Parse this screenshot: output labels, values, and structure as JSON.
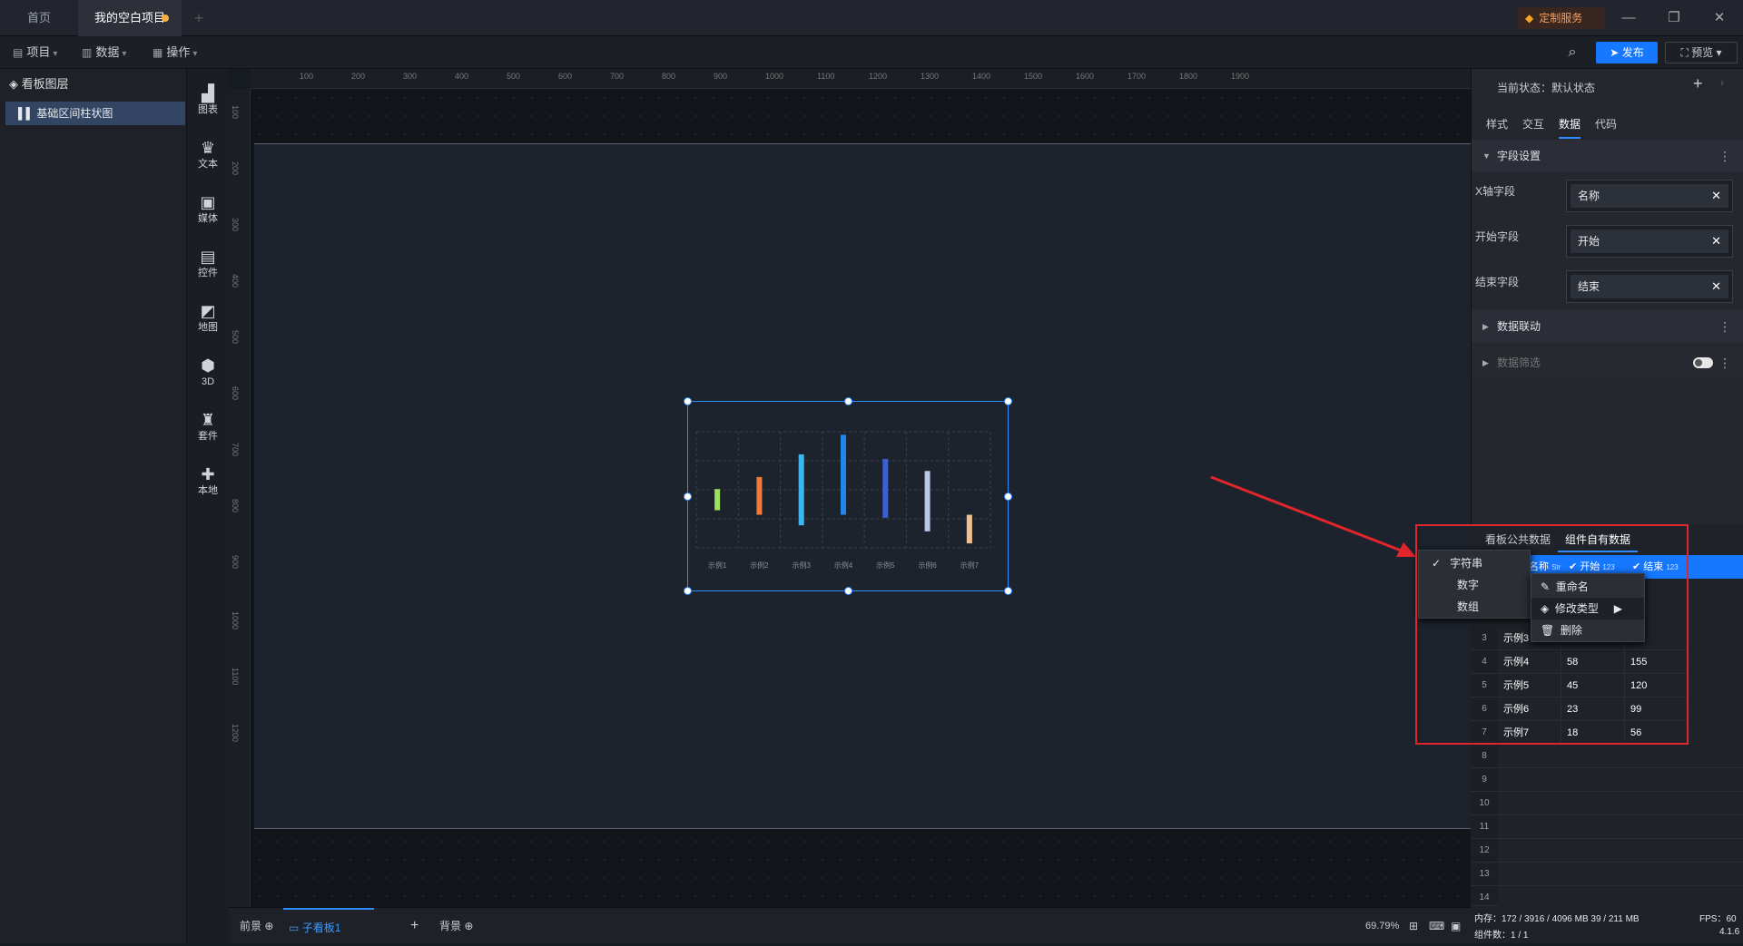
{
  "tabs": {
    "home": "首页",
    "project": "我的空白项目",
    "custom_service": "定制服务"
  },
  "menu": {
    "project": "项目",
    "data": "数据",
    "ops": "操作"
  },
  "toolbar": {
    "publish": "发布",
    "preview": "预览"
  },
  "layers": {
    "title": "看板图层",
    "item": "基础区间柱状图"
  },
  "tools": [
    "图表",
    "文本",
    "媒体",
    "控件",
    "地图",
    "3D",
    "套件",
    "本地"
  ],
  "ruler_top": [
    "100",
    "200",
    "300",
    "400",
    "500",
    "600",
    "700",
    "800",
    "900",
    "1000",
    "1100",
    "1200",
    "1300",
    "1400",
    "1500",
    "1600",
    "1700",
    "1800",
    "1900"
  ],
  "ruler_left": [
    "100",
    "200",
    "300",
    "400",
    "500",
    "600",
    "700",
    "800",
    "900",
    "1000",
    "1100",
    "1200"
  ],
  "chart_data": {
    "type": "bar",
    "categories": [
      "示例1",
      "示例2",
      "示例3",
      "示例4",
      "示例5",
      "示例6",
      "示例7"
    ],
    "ranges": [
      [
        null,
        null
      ],
      [
        null,
        null
      ],
      [
        null,
        null
      ],
      [
        null,
        null
      ],
      [
        58,
        155
      ],
      [
        45,
        120
      ],
      [
        23,
        99
      ]
    ],
    "colors": [
      "#a0e060",
      "#f07a3a",
      "#3cb6f0",
      "#2186e8",
      "#3b5fd8",
      "#b8c8e8",
      "#f0c090"
    ]
  },
  "bottom": {
    "front": "前景",
    "sub": "子看板1",
    "back": "背景",
    "zoom": "69.79%"
  },
  "panel": {
    "state_label": "当前状态：默认状态",
    "tabs": [
      "样式",
      "交互",
      "数据",
      "代码"
    ],
    "field_section": "字段设置",
    "x_label": "X轴字段",
    "x_value": "名称",
    "start_label": "开始字段",
    "start_value": "开始",
    "end_label": "结束字段",
    "end_value": "结束",
    "link_section": "数据联动",
    "filter_section": "数据筛选",
    "data_tabs": [
      "看板公共数据",
      "组件自有数据"
    ],
    "col_name": "名称",
    "col_name_type": "Str",
    "col_start": "开始",
    "col_start_type": "123",
    "col_end": "结束",
    "col_end_type": "123"
  },
  "rows": [
    {
      "n": "3",
      "name": "示例3",
      "start": "",
      "end": ""
    },
    {
      "n": "4",
      "name": "示例4",
      "start": "58",
      "end": "155"
    },
    {
      "n": "5",
      "name": "示例5",
      "start": "45",
      "end": "120"
    },
    {
      "n": "6",
      "name": "示例6",
      "start": "23",
      "end": "99"
    },
    {
      "n": "7",
      "name": "示例7",
      "start": "18",
      "end": "56"
    }
  ],
  "empty_rows": [
    "8",
    "9",
    "10",
    "11",
    "12",
    "13",
    "14"
  ],
  "type_menu": [
    "字符串",
    "数字",
    "数组"
  ],
  "action_menu": [
    "重命名",
    "修改类型",
    "删除"
  ],
  "status": {
    "memory": "内存：172 / 3916 / 4096 MB 39 / 211 MB",
    "fps": "FPS：60",
    "components": "组件数：1 / 1",
    "version": "4.1.6"
  }
}
